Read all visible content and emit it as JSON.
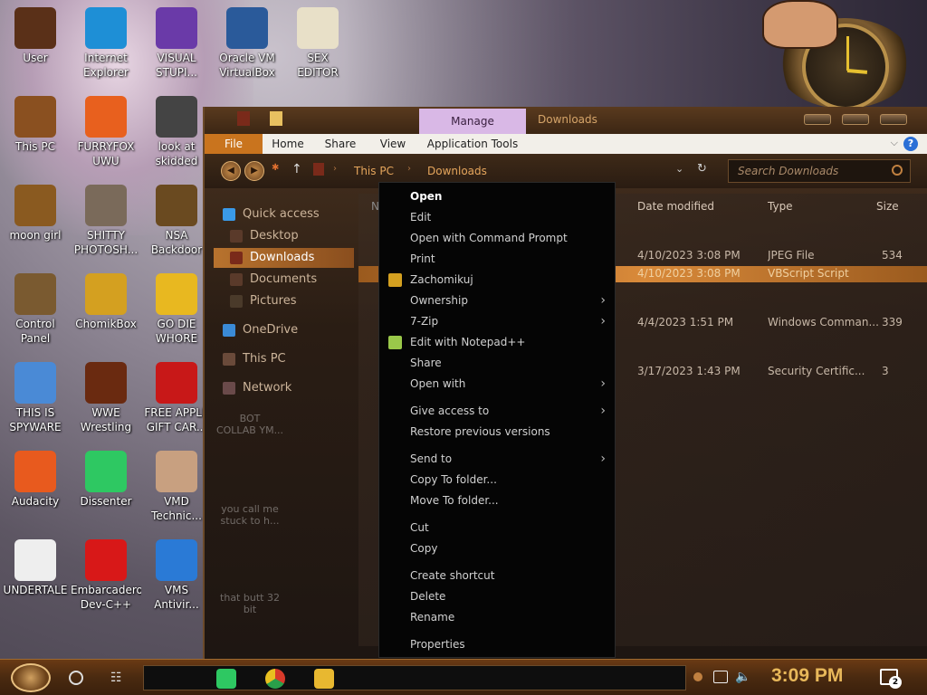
{
  "desktop": {
    "icons": [
      {
        "label": "User",
        "icon": "user-folder-icon",
        "color": "#5a3018"
      },
      {
        "label": "Internet\nExplorer",
        "icon": "edge-icon",
        "color": "#1e8fd6"
      },
      {
        "label": "VISUAL\nSTUPI...",
        "icon": "visual-studio-icon",
        "color": "#6a3aa8"
      },
      {
        "label": "Oracle VM\nVirtualBox",
        "icon": "virtualbox-icon",
        "color": "#2a5a9a"
      },
      {
        "label": "SEX\nEDITOR",
        "icon": "hxd-icon",
        "color": "#e8e0c8"
      },
      {
        "label": "This PC",
        "icon": "computer-icon",
        "color": "#8a5020"
      },
      {
        "label": "FURRYFOX\nUWU",
        "icon": "firefox-icon",
        "color": "#e8601e"
      },
      {
        "label": "look at\nskidded",
        "icon": "copy-icon",
        "color": "#444444"
      },
      {
        "label": "moon girl",
        "icon": "book-icon",
        "color": "#8a5a20"
      },
      {
        "label": "SHITTY\nPHOTOSH...",
        "icon": "gimp-icon",
        "color": "#7a6a5a"
      },
      {
        "label": "NSA\nBackdoor",
        "icon": "gear-folder-icon",
        "color": "#6a4a20"
      },
      {
        "label": "Control Panel",
        "icon": "lamp-icon",
        "color": "#7a5a30"
      },
      {
        "label": "ChomikBox",
        "icon": "chomikbox-icon",
        "color": "#d4a020"
      },
      {
        "label": "GO DIE\nWHORE",
        "icon": "de-icon",
        "color": "#e8b820"
      },
      {
        "label": "THIS IS\nSPYWARE",
        "icon": "chrome-icon",
        "color": "#4a8ad6"
      },
      {
        "label": "WWE\nWrestling",
        "icon": "fireplace-icon",
        "color": "#6a2a10"
      },
      {
        "label": "FREE APPLE\nGIFT CAR...",
        "icon": "apple-icon",
        "color": "#c81818"
      },
      {
        "label": "Audacity",
        "icon": "audacity-icon",
        "color": "#e85a1e"
      },
      {
        "label": "Dissenter",
        "icon": "dissenter-icon",
        "color": "#2ec862"
      },
      {
        "label": "VMD\nTechnic...",
        "icon": "person-icon",
        "color": "#c8a080"
      },
      {
        "label": "UNDERTALE",
        "icon": "unity-icon",
        "color": "#eeeeee"
      },
      {
        "label": "Embarcadero\nDev-C++",
        "icon": "devcpp-icon",
        "color": "#d81818"
      },
      {
        "label": "VMS\nAntivir...",
        "icon": "shield-icon",
        "color": "#2a7ad6"
      }
    ],
    "partial_labels": [
      "BOT\nCOLLAB YM...",
      "you call me\nstuck to h...",
      "that butt 32\nbit"
    ]
  },
  "explorer": {
    "title": "Downloads",
    "manage_tab": "Manage",
    "ribbon_tabs": [
      "File",
      "Home",
      "Share",
      "View",
      "Application Tools"
    ],
    "help": "?",
    "breadcrumb": [
      "This PC",
      "Downloads"
    ],
    "search_placeholder": "Search Downloads",
    "nav": [
      {
        "label": "Quick access",
        "icon": "star-icon"
      },
      {
        "label": "Desktop",
        "icon": "desktop-folder-icon"
      },
      {
        "label": "Downloads",
        "icon": "downloads-folder-icon"
      },
      {
        "label": "Documents",
        "icon": "documents-folder-icon"
      },
      {
        "label": "Pictures",
        "icon": "pictures-folder-icon"
      },
      {
        "label": "OneDrive",
        "icon": "cloud-icon"
      },
      {
        "label": "This PC",
        "icon": "computer-icon"
      },
      {
        "label": "Network",
        "icon": "network-icon"
      }
    ],
    "columns": [
      "Date modified",
      "Type",
      "Size"
    ],
    "col_partial": "N",
    "rows": [
      {
        "date": "4/10/2023 3:08 PM",
        "type": "JPEG File",
        "size": "534"
      },
      {
        "date": "4/10/2023 3:08 PM",
        "type": "VBScript Script",
        "size": ""
      },
      {
        "date": "4/4/2023 1:51 PM",
        "type": "Windows Comman...",
        "size": "339"
      },
      {
        "date": "3/17/2023 1:43 PM",
        "type": "Security Certific...",
        "size": "3"
      }
    ]
  },
  "context_menu": {
    "items": [
      {
        "label": "Open",
        "bold": true
      },
      {
        "label": "Edit"
      },
      {
        "label": "Open with Command Prompt"
      },
      {
        "label": "Print"
      },
      {
        "label": "Zachomikuj",
        "icon": "chomikbox-icon"
      },
      {
        "label": "Ownership",
        "submenu": true
      },
      {
        "label": "7-Zip",
        "submenu": true
      },
      {
        "label": "Edit with Notepad++",
        "icon": "notepadpp-icon"
      },
      {
        "label": "Share"
      },
      {
        "label": "Open with",
        "submenu": true
      },
      {
        "label": "Give access to",
        "submenu": true
      },
      {
        "label": "Restore previous versions"
      },
      {
        "label": "Send to",
        "submenu": true
      },
      {
        "label": "Copy To folder..."
      },
      {
        "label": "Move To folder..."
      },
      {
        "label": "Cut"
      },
      {
        "label": "Copy"
      },
      {
        "label": "Create shortcut"
      },
      {
        "label": "Delete"
      },
      {
        "label": "Rename"
      },
      {
        "label": "Properties"
      }
    ]
  },
  "taskbar": {
    "time": "3:09 PM",
    "notification_count": "2",
    "apps": [
      "dissenter-icon",
      "chrome-icon",
      "file-explorer-icon"
    ]
  },
  "colors": {
    "accent": "#c9741e",
    "manage_tab": "#d9b8e6",
    "clock_text": "#e8b85a"
  }
}
